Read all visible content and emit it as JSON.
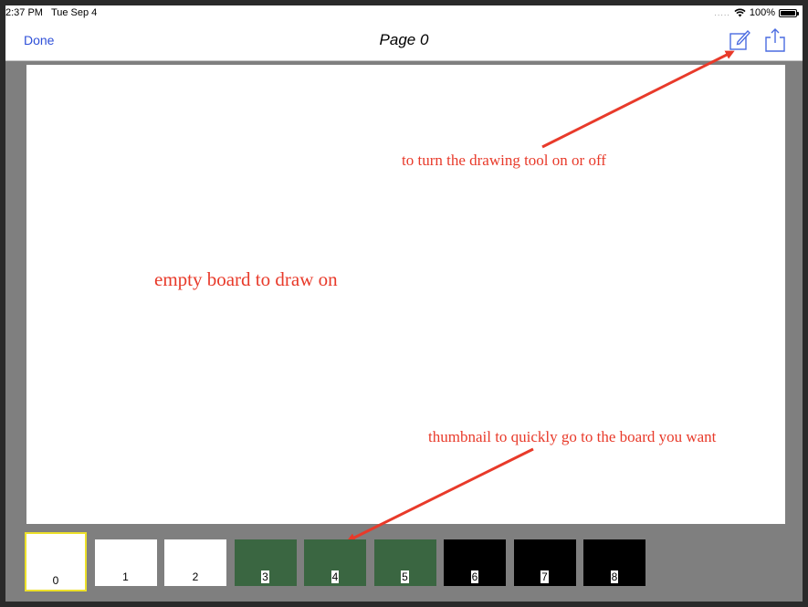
{
  "status": {
    "time": "2:37 PM",
    "date": "Tue Sep 4",
    "signal": ".....",
    "battery": "100%"
  },
  "nav": {
    "done": "Done",
    "title": "Page 0",
    "edit_icon": "compose-icon",
    "share_icon": "share-icon"
  },
  "annotations": {
    "toggle_tool": "to turn the drawing tool on or off",
    "empty_board": "empty board to draw on",
    "thumbnail": "thumbnail to quickly go to the board you want"
  },
  "colors": {
    "accent": "#2f50d8",
    "annotation": "#e83a2a",
    "selected": "#ece02a",
    "green": "#3a6641",
    "white": "#ffffff",
    "black": "#000000"
  },
  "thumbnails": [
    {
      "label": "0",
      "color": "white",
      "selected": true
    },
    {
      "label": "1",
      "color": "white"
    },
    {
      "label": "2",
      "color": "white"
    },
    {
      "label": "3",
      "color": "green"
    },
    {
      "label": "4",
      "color": "green"
    },
    {
      "label": "5",
      "color": "green"
    },
    {
      "label": "6",
      "color": "black"
    },
    {
      "label": "7",
      "color": "black"
    },
    {
      "label": "8",
      "color": "black"
    }
  ]
}
